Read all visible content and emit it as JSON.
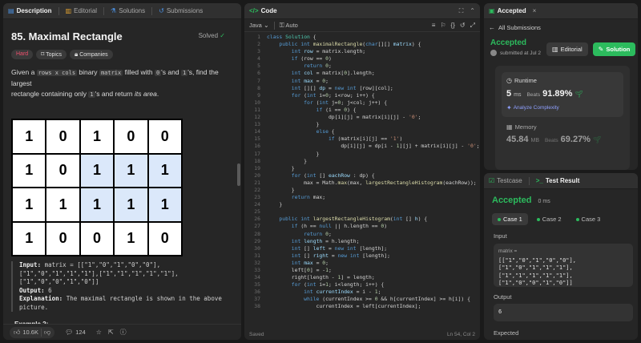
{
  "left": {
    "tabs": [
      "Description",
      "Editorial",
      "Solutions",
      "Submissions"
    ],
    "title": "85. Maximal Rectangle",
    "solved": "Solved",
    "chips": [
      "Hard",
      "Topics",
      "Companies"
    ],
    "desc": {
      "p1": "Given a",
      "c1": "rows x cols",
      "p2": "binary",
      "c2": "matrix",
      "p3": "filled with",
      "c3": "0",
      "p4": "'s and",
      "c4": "1",
      "p5": "'s, find the largest",
      "p6": "rectangle containing only",
      "c5": "1",
      "p7": "'s and return",
      "p8": "its area",
      "p9": "."
    },
    "example1": "Example 1:",
    "matrix": [
      [
        "1",
        "0",
        "1",
        "0",
        "0"
      ],
      [
        "1",
        "0",
        "1",
        "1",
        "1"
      ],
      [
        "1",
        "1",
        "1",
        "1",
        "1"
      ],
      [
        "1",
        "0",
        "0",
        "1",
        "0"
      ]
    ],
    "io": {
      "input_label": "Input:",
      "input_l1": " matrix = [[\"1\",\"0\",\"1\",\"0\",\"0\"],",
      "input_l2": "[\"1\",\"0\",\"1\",\"1\",\"1\"],[\"1\",\"1\",\"1\",\"1\",\"1\"],",
      "input_l3": "[\"1\",\"0\",\"0\",\"1\",\"0\"]]",
      "output_label": "Output:",
      "output": " 6",
      "expl_label": "Explanation:",
      "expl_l1": " The maximal rectangle is shown in the above",
      "expl_l2": "picture."
    },
    "example2": "Example 2:",
    "footer": {
      "likes": "10.6K",
      "comments": "124"
    }
  },
  "mid": {
    "tab": "Code",
    "language": "Java",
    "mode": "Auto",
    "status": "Saved",
    "cursor": "Ln 54, Col 2"
  },
  "rtop": {
    "tab": "Accepted",
    "back": "All Submissions",
    "status": "Accepted",
    "submitted": "submitted at Jul 2",
    "editorial_btn": "Editorial",
    "solution_btn": "Solution",
    "runtime_label": "Runtime",
    "runtime_value": "5",
    "runtime_unit": "ms",
    "beats_label": "Beats",
    "runtime_beats": "91.89%",
    "analyze": "Analyze Complexity",
    "memory_label": "Memory",
    "memory_value": "45.84",
    "memory_unit": "MB",
    "memory_beats": "69.27%"
  },
  "rbot": {
    "tabs": [
      "Testcase",
      "Test Result"
    ],
    "status": "Accepted",
    "runtime": "0 ms",
    "cases": [
      "Case 1",
      "Case 2",
      "Case 3"
    ],
    "input_label": "Input",
    "var_name": "matrix =",
    "var_value": "[[\"1\",\"0\",\"1\",\"0\",\"0\"],[\"1\",\"0\",\"1\",\"1\",\"1\"],[\"1\",\"1\",\"1\",\"1\",\"1\"],[\"1\",\"0\",\"0\",\"1\",\"0\"]]",
    "output_label": "Output",
    "output_value": "6",
    "expected_label": "Expected"
  },
  "colors": {
    "accent_green": "#2cbb5d",
    "hard_red": "#f0506e",
    "highlight_blue": "#dbe8fa"
  },
  "icons": [
    "description-icon",
    "editorial-icon",
    "solutions-icon",
    "submissions-icon",
    "code-icon",
    "check-icon",
    "tag-icon",
    "lock-icon",
    "thumbs-up-icon",
    "thumbs-down-icon",
    "comment-icon",
    "star-icon",
    "share-icon",
    "help-icon",
    "flask-icon",
    "terminal-icon",
    "clock-icon",
    "memory-icon",
    "back-arrow-icon"
  ]
}
